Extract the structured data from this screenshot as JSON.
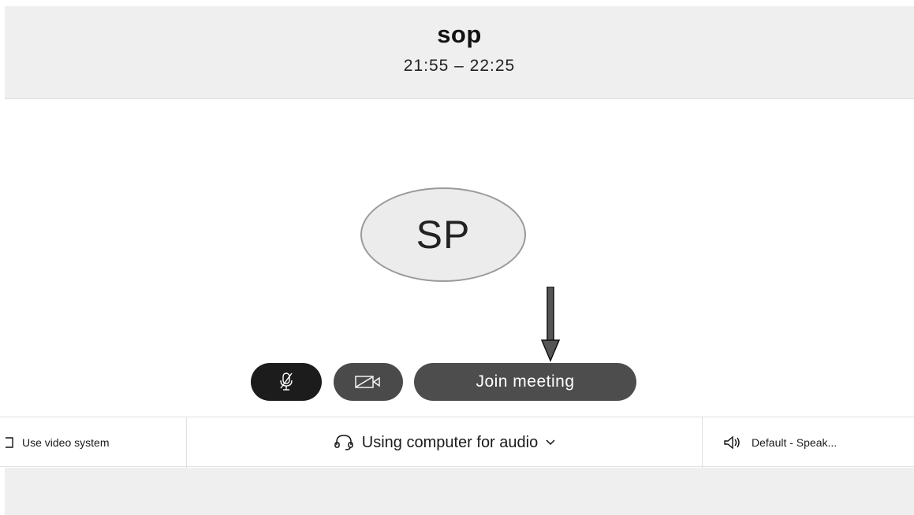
{
  "header": {
    "title": "sop",
    "time_range": "21:55 – 22:25"
  },
  "avatar": {
    "initials": "SP"
  },
  "controls": {
    "mute_icon": "microphone-muted-icon",
    "video_icon": "video-off-icon",
    "join_label": "Join meeting"
  },
  "audio_bar": {
    "video_system_label": "Use video system",
    "audio_label": "Using computer for audio",
    "speaker_label": "Default - Speak..."
  },
  "colors": {
    "header_bg": "#efefef",
    "mute_button": "#1c1c1c",
    "video_button": "#4a4a4a",
    "join_button": "#4d4d4d"
  }
}
